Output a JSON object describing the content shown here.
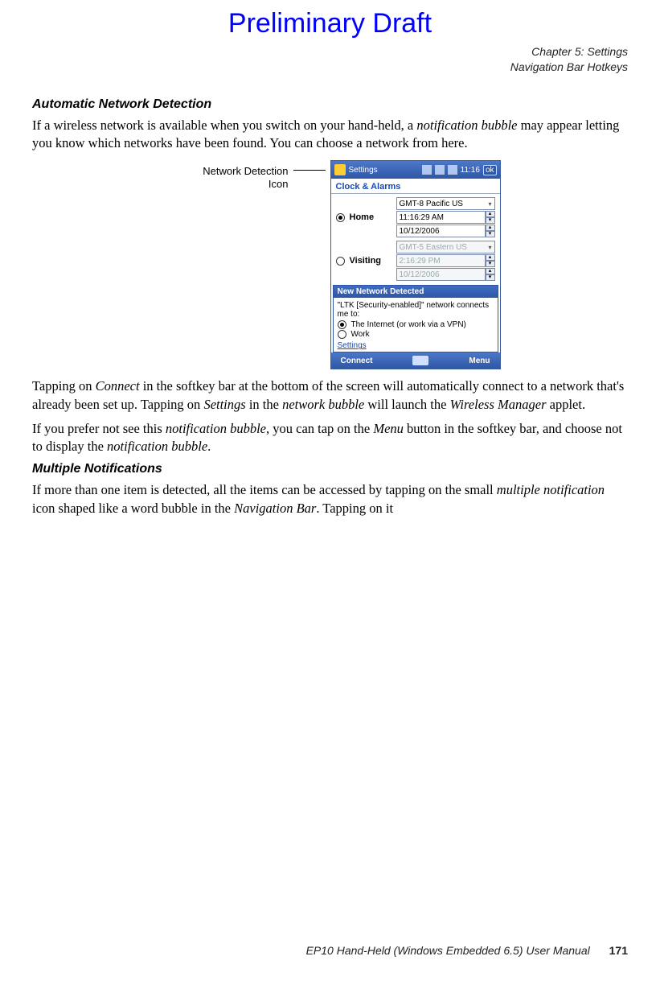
{
  "header": {
    "draft": "Preliminary Draft"
  },
  "meta": {
    "chapter": "Chapter 5:  Settings",
    "section": "Navigation Bar Hotkeys"
  },
  "s1": {
    "title": "Automatic Network Detection",
    "p1a": " If a wireless network is available when you switch on your hand-held, a ",
    "p1b": "notification bubble",
    "p1c": " may appear letting you know which networks have been found. You can choose a network from here."
  },
  "callout": {
    "line1": "Network Detection",
    "line2": "Icon"
  },
  "device": {
    "title": "Settings",
    "time": "11:16",
    "ok": "ok",
    "subtitle": "Clock & Alarms",
    "home": {
      "label": "Home",
      "tz": "GMT-8 Pacific US",
      "time": "11:16:29 AM",
      "date": "10/12/2006"
    },
    "visiting": {
      "label": "Visiting",
      "tz": "GMT-5 Eastern US",
      "time": "2:16:29 PM",
      "date": "10/12/2006"
    },
    "popup": {
      "title": "New Network Detected",
      "text": "\"LTK [Security-enabled]\" network connects me to:",
      "opt1": "The Internet (or work via a VPN)",
      "opt2": "Work",
      "settings": "Settings"
    },
    "softLeft": "Connect",
    "softRight": "Menu"
  },
  "s2": {
    "p1a": "Tapping on ",
    "p1b": "Connect",
    "p1c": " in the softkey bar at the bottom of the screen will automatically connect to a network that's already been set up. Tapping on ",
    "p1d": "Settings",
    "p1e": " in the ",
    "p1f": "network bubble",
    "p1g": " will launch the ",
    "p1h": "Wireless Manager",
    "p1i": " applet.",
    "p2a": "If you prefer not see this ",
    "p2b": "notification bubble",
    "p2c": ", you can tap on the ",
    "p2d": "Menu",
    "p2e": " button in the softkey bar, and choose not to display the ",
    "p2f": "notification bubble",
    "p2g": "."
  },
  "s3": {
    "title": "Multiple Notifications",
    "p1a": "If more than one item is detected, all the items can be accessed by tapping on the small ",
    "p1b": "mul­tiple notification",
    "p1c": " icon shaped like a word bubble in the ",
    "p1d": "Navigation Bar",
    "p1e": ". Tapping on it"
  },
  "footer": {
    "text": "EP10 Hand-Held (Windows Embedded 6.5) User Manual",
    "page": "171"
  }
}
